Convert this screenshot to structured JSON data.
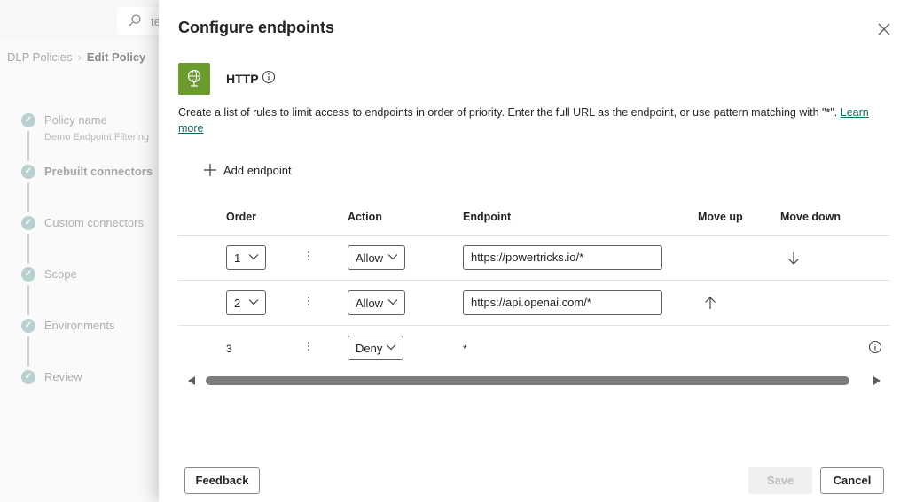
{
  "background": {
    "search_text": "te",
    "breadcrumb": {
      "root": "DLP Policies",
      "current": "Edit Policy"
    },
    "steps": [
      {
        "label": "Policy name",
        "sub": "Demo Endpoint Filtering"
      },
      {
        "label": "Prebuilt connectors"
      },
      {
        "label": "Custom connectors"
      },
      {
        "label": "Scope"
      },
      {
        "label": "Environments"
      },
      {
        "label": "Review"
      }
    ]
  },
  "panel": {
    "title": "Configure endpoints",
    "connector_name": "HTTP",
    "connector_color": "#6b9a2d",
    "description": "Create a list of rules to limit access to endpoints in order of priority. Enter the full URL as the endpoint, or use pattern matching with \"*\".",
    "learn_more": "Learn more",
    "add_endpoint": "Add endpoint"
  },
  "table": {
    "headers": {
      "order": "Order",
      "action": "Action",
      "endpoint": "Endpoint",
      "move_up": "Move up",
      "move_down": "Move down"
    },
    "rows": [
      {
        "order": "1",
        "action": "Allow",
        "endpoint": "https://powertricks.io/*"
      },
      {
        "order": "2",
        "action": "Allow",
        "endpoint": "https://api.openai.com/*"
      },
      {
        "order": "3",
        "action": "Deny",
        "endpoint": "*"
      }
    ]
  },
  "footer": {
    "feedback": "Feedback",
    "save": "Save",
    "cancel": "Cancel"
  },
  "icons": [
    "search-icon",
    "checkmark-icon",
    "close-icon",
    "globe-icon",
    "info-icon",
    "plus-icon",
    "chevron-down-icon",
    "more-vertical-icon",
    "arrow-down-icon",
    "arrow-up-icon",
    "scroll-left-icon",
    "scroll-right-icon"
  ]
}
